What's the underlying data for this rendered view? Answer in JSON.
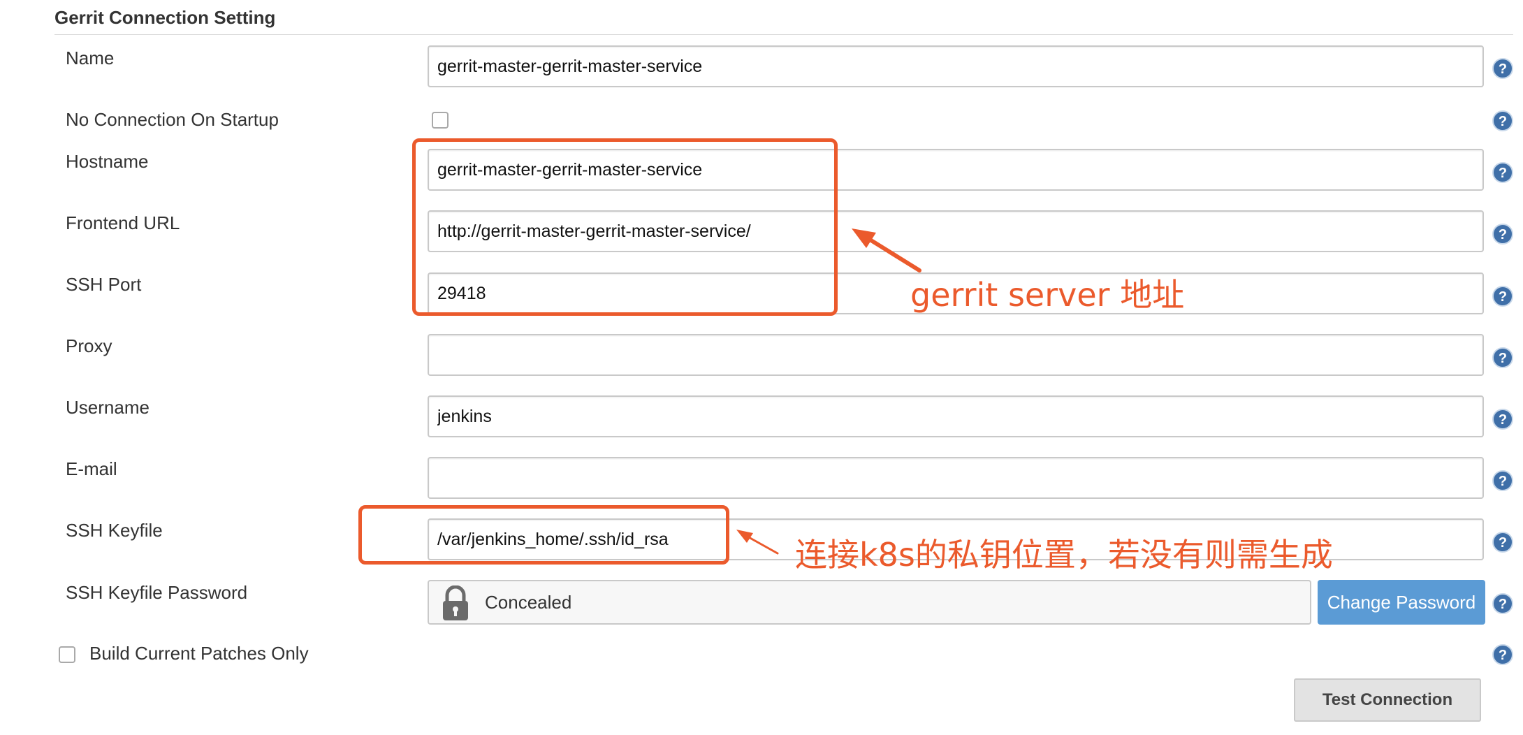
{
  "section": {
    "title": "Gerrit Connection Setting"
  },
  "fields": {
    "name": {
      "label": "Name",
      "value": "gerrit-master-gerrit-master-service"
    },
    "no_connection": {
      "label": "No Connection On Startup",
      "checked": false
    },
    "hostname": {
      "label": "Hostname",
      "value": "gerrit-master-gerrit-master-service"
    },
    "frontend_url": {
      "label": "Frontend URL",
      "value": "http://gerrit-master-gerrit-master-service/"
    },
    "ssh_port": {
      "label": "SSH Port",
      "value": "29418"
    },
    "proxy": {
      "label": "Proxy",
      "value": ""
    },
    "username": {
      "label": "Username",
      "value": "jenkins"
    },
    "email": {
      "label": "E-mail",
      "value": ""
    },
    "ssh_keyfile": {
      "label": "SSH Keyfile",
      "value": "/var/jenkins_home/.ssh/id_rsa"
    },
    "ssh_keyfile_password": {
      "label": "SSH Keyfile Password",
      "concealed_text": "Concealed",
      "change_label": "Change Password"
    },
    "build_current_patches": {
      "label": "Build Current Patches Only",
      "checked": false
    }
  },
  "actions": {
    "test_connection": "Test Connection"
  },
  "annotations": {
    "server_address": "gerrit server 地址",
    "keyfile_note": "连接k8s的私钥位置，若没有则需生成"
  },
  "colors": {
    "annotation": "#eb5a2c",
    "primary_button": "#5b9bd5",
    "help_icon": "#3f6fa8"
  },
  "icons": {
    "help": "question-mark-circle-icon",
    "lock": "lock-icon"
  }
}
